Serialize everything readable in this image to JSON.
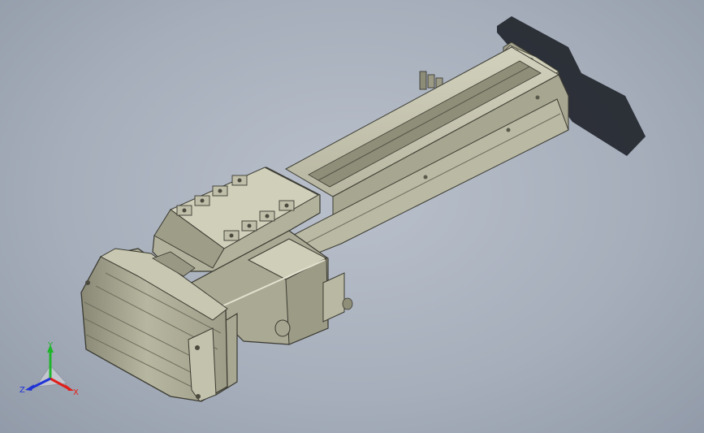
{
  "viewport": {
    "background_top": "#b9c0cb",
    "background_bottom": "#8e97a5",
    "model_color": "#b8b7a2",
    "shadow_color": "#1f2229"
  },
  "triad": {
    "x_label": "X",
    "y_label": "Y",
    "z_label": "Z",
    "x_color": "#e0201a",
    "y_color": "#1fb52a",
    "z_color": "#1f33d6"
  }
}
